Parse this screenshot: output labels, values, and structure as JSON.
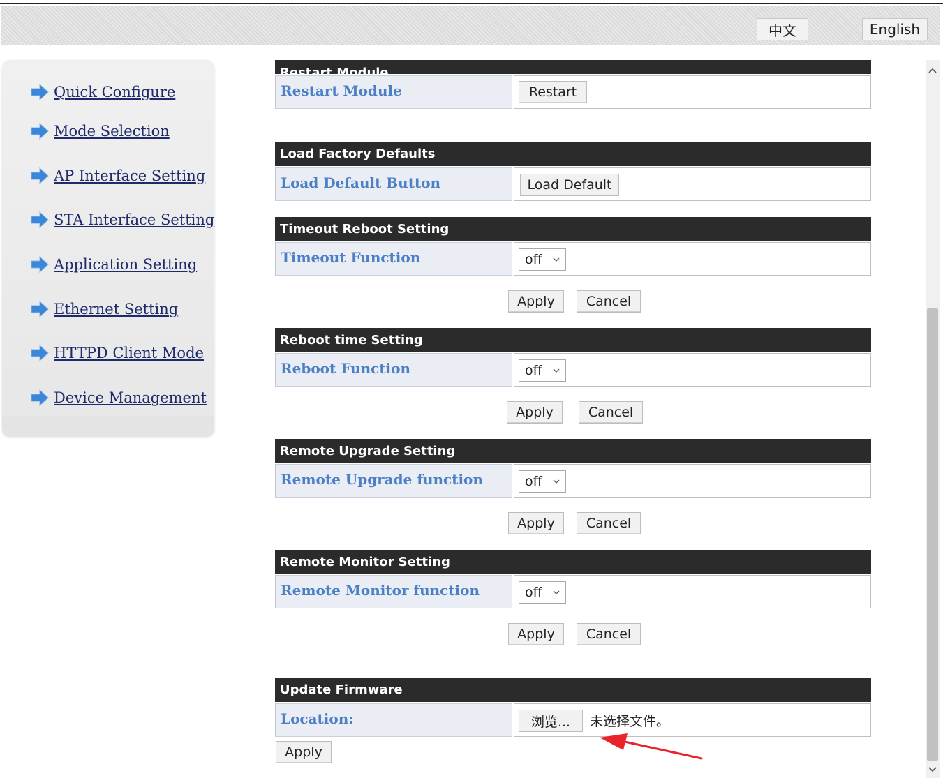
{
  "topbar": {
    "lang_chinese": "中文",
    "lang_english": "English"
  },
  "sidebar": {
    "items": [
      {
        "label": "Quick Configure"
      },
      {
        "label": "Mode Selection"
      },
      {
        "label": "AP Interface Setting"
      },
      {
        "label": "STA Interface Setting"
      },
      {
        "label": "Application Setting"
      },
      {
        "label": "Ethernet Setting"
      },
      {
        "label": "HTTPD Client Mode"
      },
      {
        "label": "Device Management"
      }
    ]
  },
  "sections": {
    "restart": {
      "header": "Restart Module",
      "label": "Restart Module",
      "button": "Restart"
    },
    "factory": {
      "header": "Load Factory Defaults",
      "label": "Load Default Button",
      "button": "Load Default"
    },
    "timeout": {
      "header": "Timeout Reboot Setting",
      "label": "Timeout Function",
      "value": "off",
      "apply": "Apply",
      "cancel": "Cancel"
    },
    "reboot_time": {
      "header": "Reboot time Setting",
      "label": "Reboot Function",
      "value": "off",
      "apply": "Apply",
      "cancel": "Cancel"
    },
    "remote_upgrade": {
      "header": "Remote Upgrade Setting",
      "label": "Remote Upgrade function",
      "value": "off",
      "apply": "Apply",
      "cancel": "Cancel"
    },
    "remote_monitor": {
      "header": "Remote Monitor Setting",
      "label": "Remote Monitor function",
      "value": "off",
      "apply": "Apply",
      "cancel": "Cancel"
    },
    "firmware": {
      "header": "Update Firmware",
      "label": "Location:",
      "browse": "浏览...",
      "file_status": "未选择文件。",
      "apply": "Apply"
    }
  },
  "colors": {
    "header_bg": "#2b2b2b",
    "label_text": "#4b7fc6",
    "nav_text": "#1f2a6b",
    "nav_arrow": "#3a86d8",
    "annotation_arrow": "#e8242a"
  }
}
